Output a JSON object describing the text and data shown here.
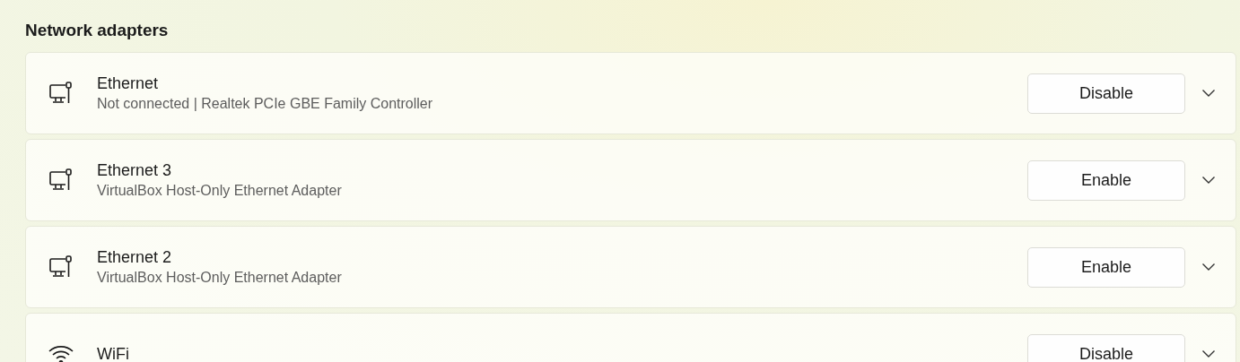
{
  "section_title": "Network adapters",
  "adapters": [
    {
      "kind": "ethernet",
      "name": "Ethernet",
      "description": "Not connected | Realtek PCIe GBE Family Controller",
      "action": "Disable"
    },
    {
      "kind": "ethernet",
      "name": "Ethernet 3",
      "description": "VirtualBox Host-Only Ethernet Adapter",
      "action": "Enable"
    },
    {
      "kind": "ethernet",
      "name": "Ethernet 2",
      "description": "VirtualBox Host-Only Ethernet Adapter",
      "action": "Enable"
    },
    {
      "kind": "wifi",
      "name": "WiFi",
      "action": "Disable"
    }
  ]
}
